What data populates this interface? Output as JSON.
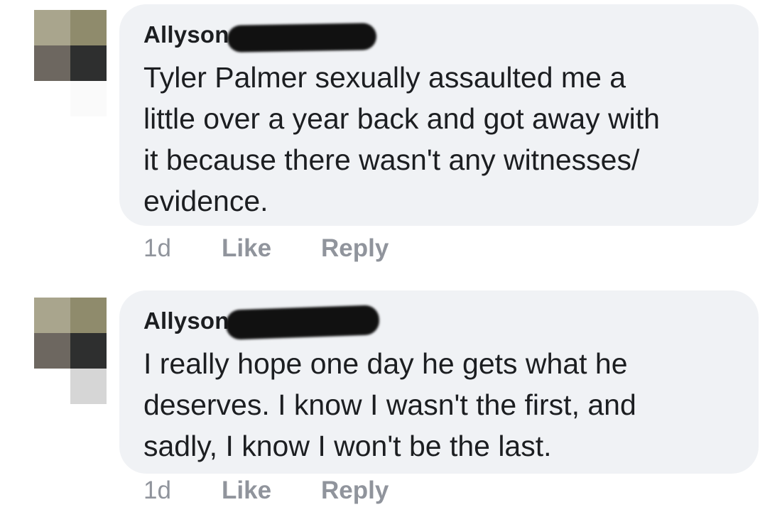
{
  "comments": [
    {
      "author": "Allyson",
      "text": "Tyler Palmer sexually assaulted me a\nlittle over a year back and got away with\nit because there wasn't any witnesses/\nevidence.",
      "time": "1d",
      "like_label": "Like",
      "reply_label": "Reply"
    },
    {
      "author": "Allyson",
      "text": "I really hope one day he gets what he\ndeserves. I know I wasn't the first, and\nsadly, I know I won't be the last.",
      "time": "1d",
      "like_label": "Like",
      "reply_label": "Reply"
    }
  ],
  "colors": {
    "bubble": "#f0f2f5",
    "text": "#1c1e21",
    "meta": "#90949c"
  }
}
